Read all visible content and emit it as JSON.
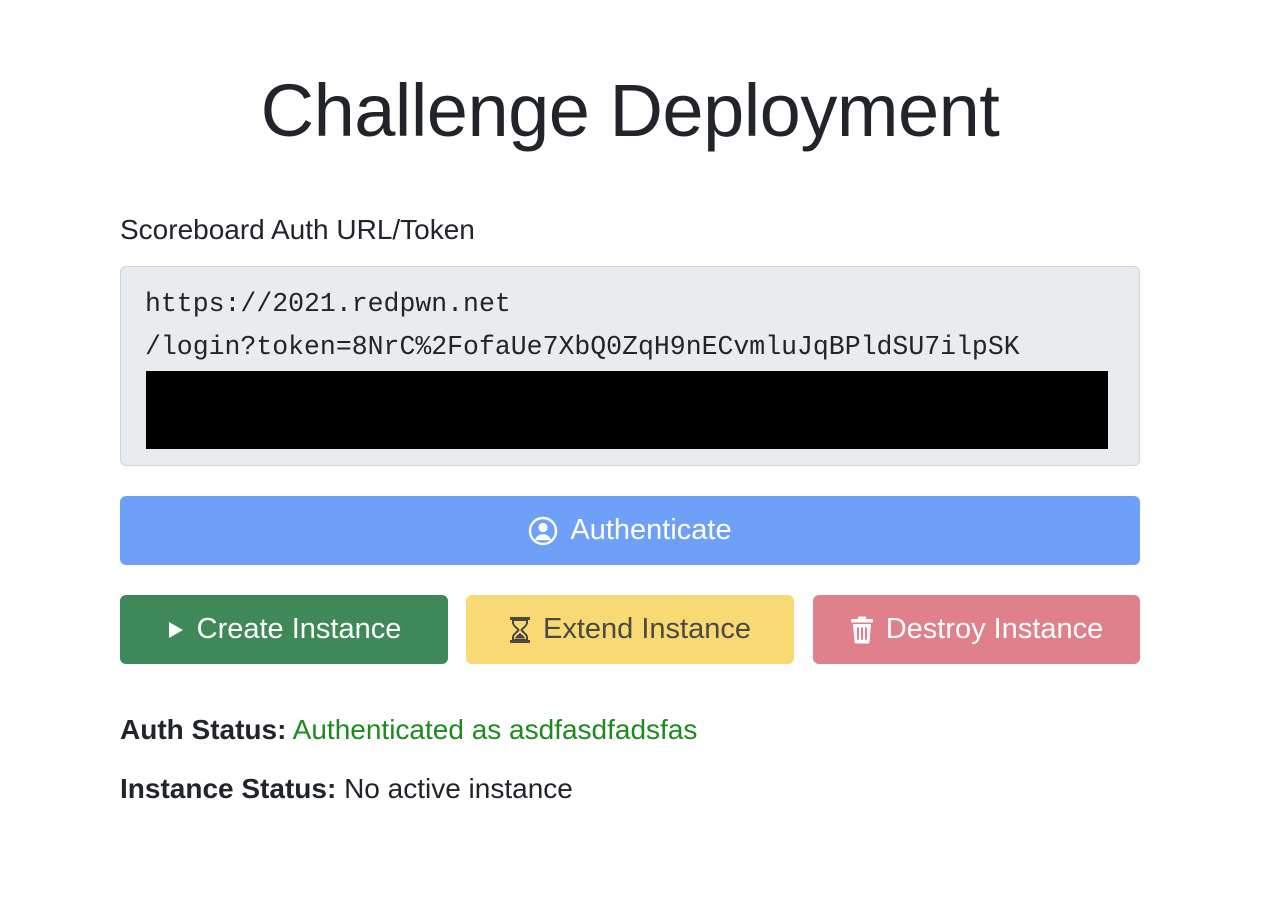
{
  "page": {
    "title": "Challenge Deployment"
  },
  "auth_field": {
    "label": "Scoreboard Auth URL/Token",
    "value_line_1": "https://2021.redpwn.net",
    "value_line_2": "/login?token=8NrC%2FofaUe7XbQ0ZqH9nECvmluJqBPldSU7ilpSK",
    "redacted": true
  },
  "buttons": {
    "authenticate": {
      "label": "Authenticate",
      "icon": "user-circle-icon",
      "color": "#6ea0f7"
    },
    "create": {
      "label": "Create Instance",
      "icon": "play-icon",
      "color": "#3f8858"
    },
    "extend": {
      "label": "Extend Instance",
      "icon": "hourglass-icon",
      "color": "#f8d974"
    },
    "destroy": {
      "label": "Destroy Instance",
      "icon": "trash-icon",
      "color": "#e0808a"
    }
  },
  "status": {
    "auth_label": "Auth Status:",
    "auth_value": "Authenticated as asdfasdfadsfas",
    "auth_value_color": "#1e8a1e",
    "instance_label": "Instance Status:",
    "instance_value": "No active instance"
  }
}
